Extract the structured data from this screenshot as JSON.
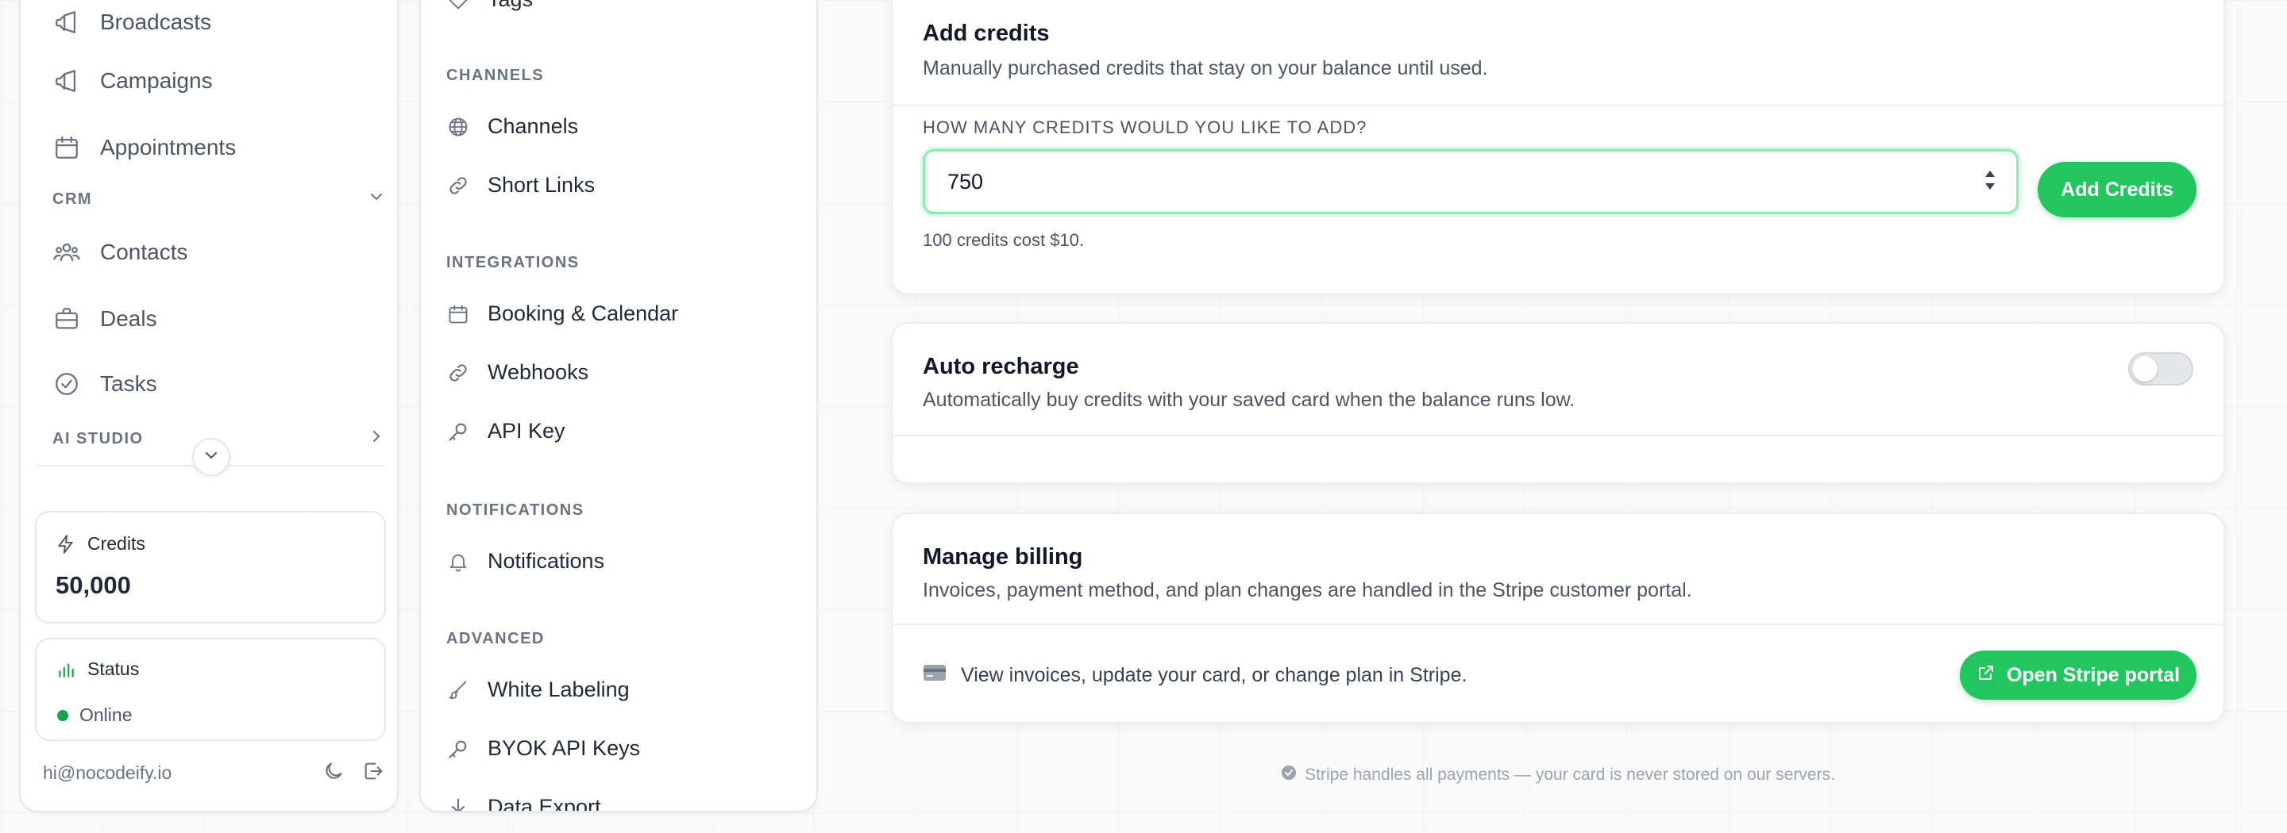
{
  "sidebar": {
    "items": [
      {
        "label": "Broadcasts",
        "icon": "megaphone-icon"
      },
      {
        "label": "Campaigns",
        "icon": "megaphone-icon"
      },
      {
        "label": "Appointments",
        "icon": "calendar-icon"
      },
      {
        "label": "Contacts",
        "icon": "users-icon"
      },
      {
        "label": "Deals",
        "icon": "briefcase-icon"
      },
      {
        "label": "Tasks",
        "icon": "check-circle-icon"
      }
    ],
    "crm_heading": "CRM",
    "ai_heading": "AI STUDIO",
    "credits": {
      "label": "Credits",
      "value": "50,000"
    },
    "status": {
      "label": "Status",
      "value": "Online",
      "color": "#16a34a"
    },
    "email": "hi@nocodeify.io"
  },
  "settings_nav": {
    "top_item": "Tags",
    "sections": [
      {
        "heading": "CHANNELS",
        "items": [
          "Channels",
          "Short Links"
        ]
      },
      {
        "heading": "INTEGRATIONS",
        "items": [
          "Booking & Calendar",
          "Webhooks",
          "API Key"
        ]
      },
      {
        "heading": "NOTIFICATIONS",
        "items": [
          "Notifications"
        ]
      },
      {
        "heading": "ADVANCED",
        "items": [
          "White Labeling",
          "BYOK API Keys",
          "Data Export"
        ]
      }
    ]
  },
  "add_credits": {
    "title": "Add credits",
    "description": "Manually purchased credits that stay on your balance until used.",
    "field_label": "HOW MANY CREDITS WOULD YOU LIKE TO ADD?",
    "value": "750",
    "button": "Add Credits",
    "hint": "100 credits cost $10."
  },
  "auto_recharge": {
    "title": "Auto recharge",
    "description": "Automatically buy credits with your saved card when the balance runs low.",
    "enabled": false
  },
  "billing": {
    "title": "Manage billing",
    "description": "Invoices, payment method, and plan changes are handled in the Stripe customer portal.",
    "row_text": "View invoices, update your card, or change plan in Stripe.",
    "button": "Open Stripe portal"
  },
  "footnote": "Stripe handles all payments — your card is never stored on our servers.",
  "colors": {
    "accent": "#22c55e",
    "accent_light": "#86efac",
    "online": "#16a34a"
  }
}
